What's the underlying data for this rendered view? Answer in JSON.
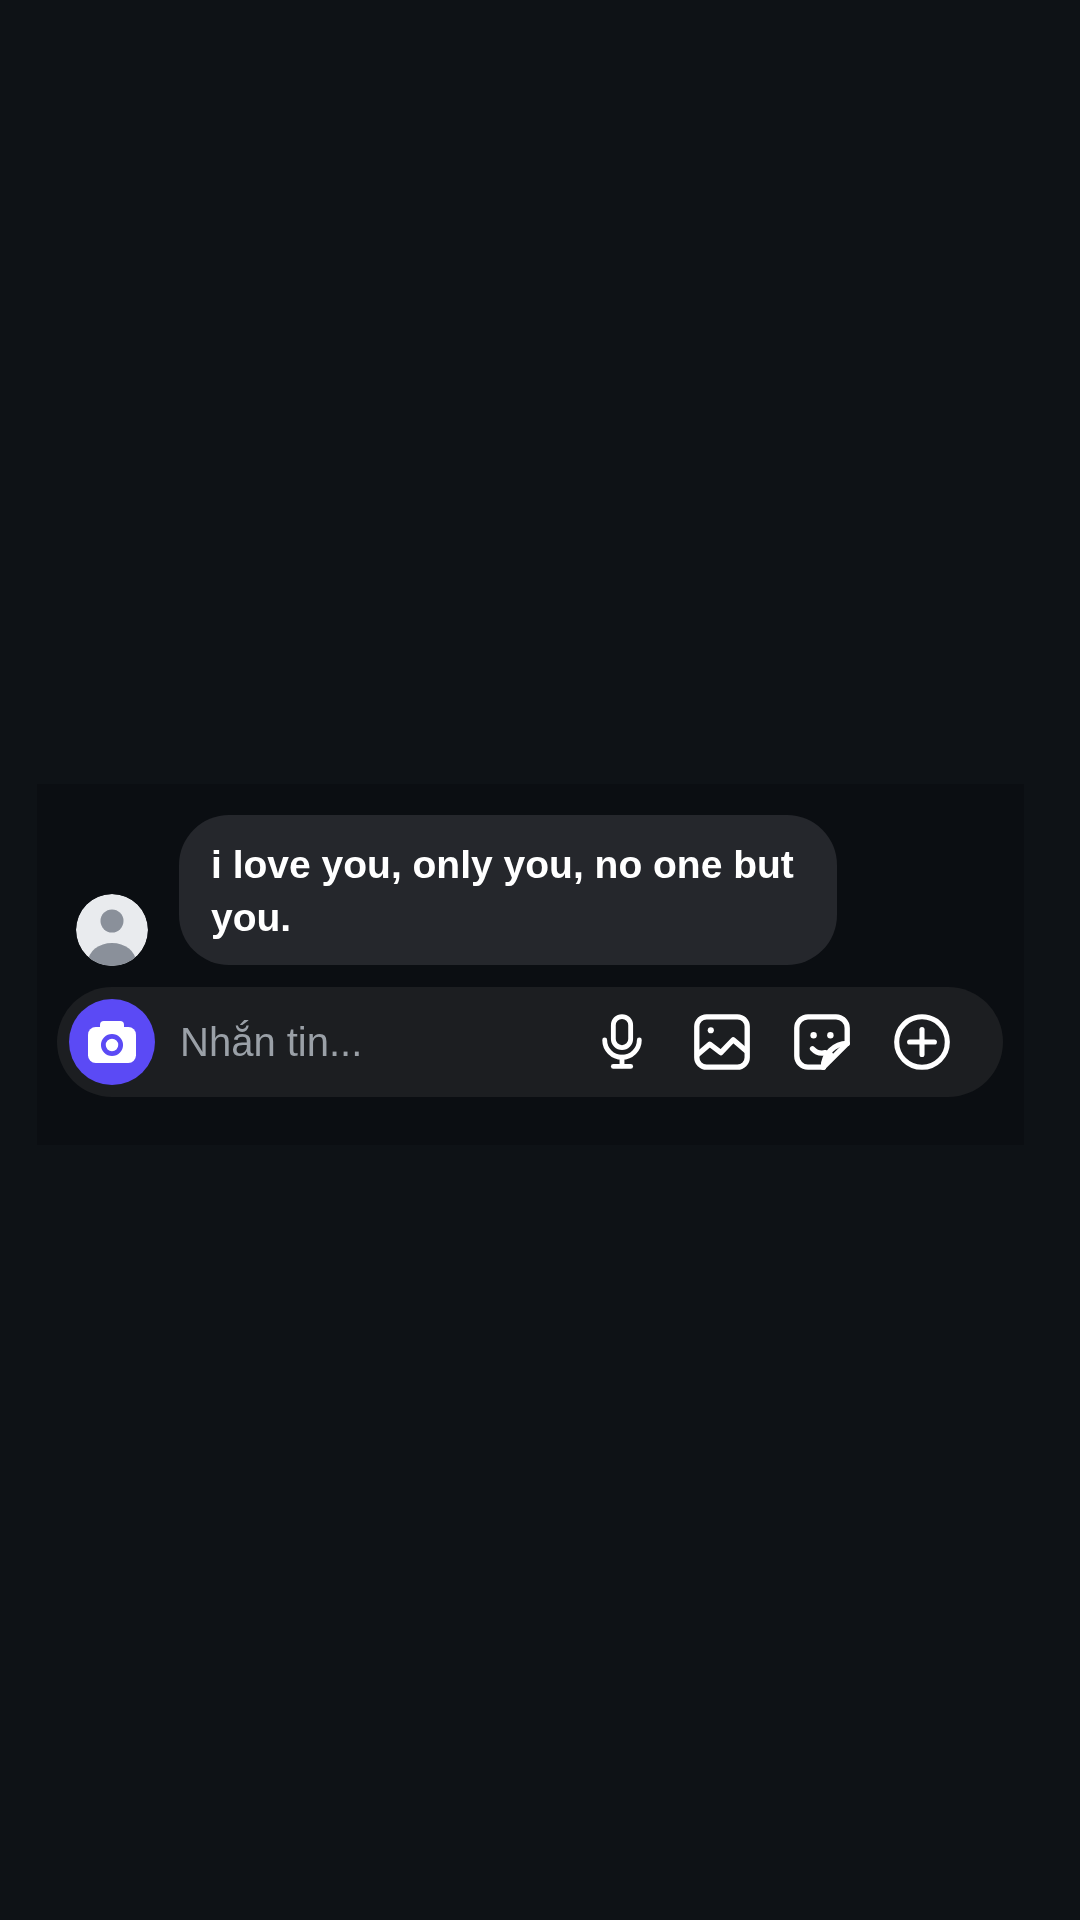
{
  "messages": [
    {
      "text": "i love you, only you, no one but you."
    }
  ],
  "composer": {
    "placeholder": "Nhắn tin..."
  }
}
